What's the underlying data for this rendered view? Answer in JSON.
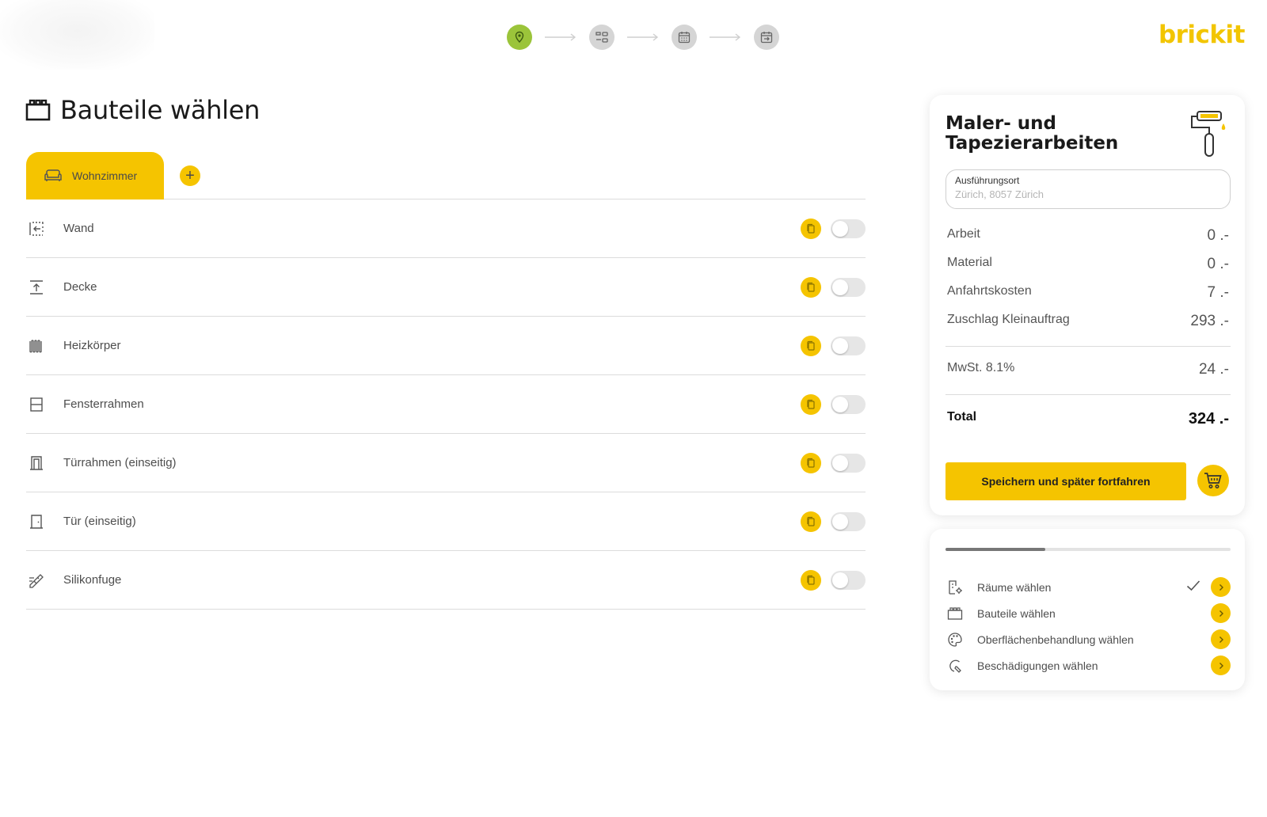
{
  "header": {
    "brand": "brickit",
    "stepper": [
      {
        "icon": "location-pin-icon",
        "state": "active"
      },
      {
        "icon": "components-icon",
        "state": "inactive"
      },
      {
        "icon": "calendar-icon",
        "state": "inactive"
      },
      {
        "icon": "calendar-transfer-icon",
        "state": "inactive"
      }
    ]
  },
  "page": {
    "title": "Bauteile wählen",
    "title_icon": "components-icon"
  },
  "tabs": {
    "active_label": "Wohnzimmer",
    "active_icon": "sofa-icon",
    "add_label": "+"
  },
  "components": [
    {
      "label": "Wand",
      "icon": "wall-icon",
      "enabled": false
    },
    {
      "label": "Decke",
      "icon": "ceiling-icon",
      "enabled": false
    },
    {
      "label": "Heizkörper",
      "icon": "radiator-icon",
      "enabled": false
    },
    {
      "label": "Fensterrahmen",
      "icon": "window-frame-icon",
      "enabled": false
    },
    {
      "label": "Türrahmen (einseitig)",
      "icon": "door-frame-icon",
      "enabled": false
    },
    {
      "label": "Tür (einseitig)",
      "icon": "door-icon",
      "enabled": false
    },
    {
      "label": "Silikonfuge",
      "icon": "silicone-joint-icon",
      "enabled": false
    }
  ],
  "summary": {
    "title": "Maler- und Tapezierarbeiten",
    "location_label": "Ausführungsort",
    "location_value": "Zürich, 8057 Zürich",
    "costs": [
      {
        "label": "Arbeit",
        "value": "0 .-"
      },
      {
        "label": "Material",
        "value": "0 .-"
      },
      {
        "label": "Anfahrtskosten",
        "value": "7 .-"
      },
      {
        "label": "Zuschlag Kleinauftrag",
        "value": "293 .-"
      }
    ],
    "vat": {
      "label": "MwSt. 8.1%",
      "value": "24 .-"
    },
    "total": {
      "label": "Total",
      "value": "324 .-"
    },
    "save_label": "Speichern und später fortfahren",
    "colors": {
      "accent": "#f5c400",
      "active_step": "#9bc43a"
    }
  },
  "progress": {
    "fraction": 0.35,
    "steps": [
      {
        "label": "Räume wählen",
        "icon": "room-settings-icon",
        "done": true
      },
      {
        "label": "Bauteile wählen",
        "icon": "components-icon",
        "done": false
      },
      {
        "label": "Oberflächenbehandlung wählen",
        "icon": "palette-icon",
        "done": false
      },
      {
        "label": "Beschädigungen wählen",
        "icon": "damage-repair-icon",
        "done": false
      }
    ]
  }
}
